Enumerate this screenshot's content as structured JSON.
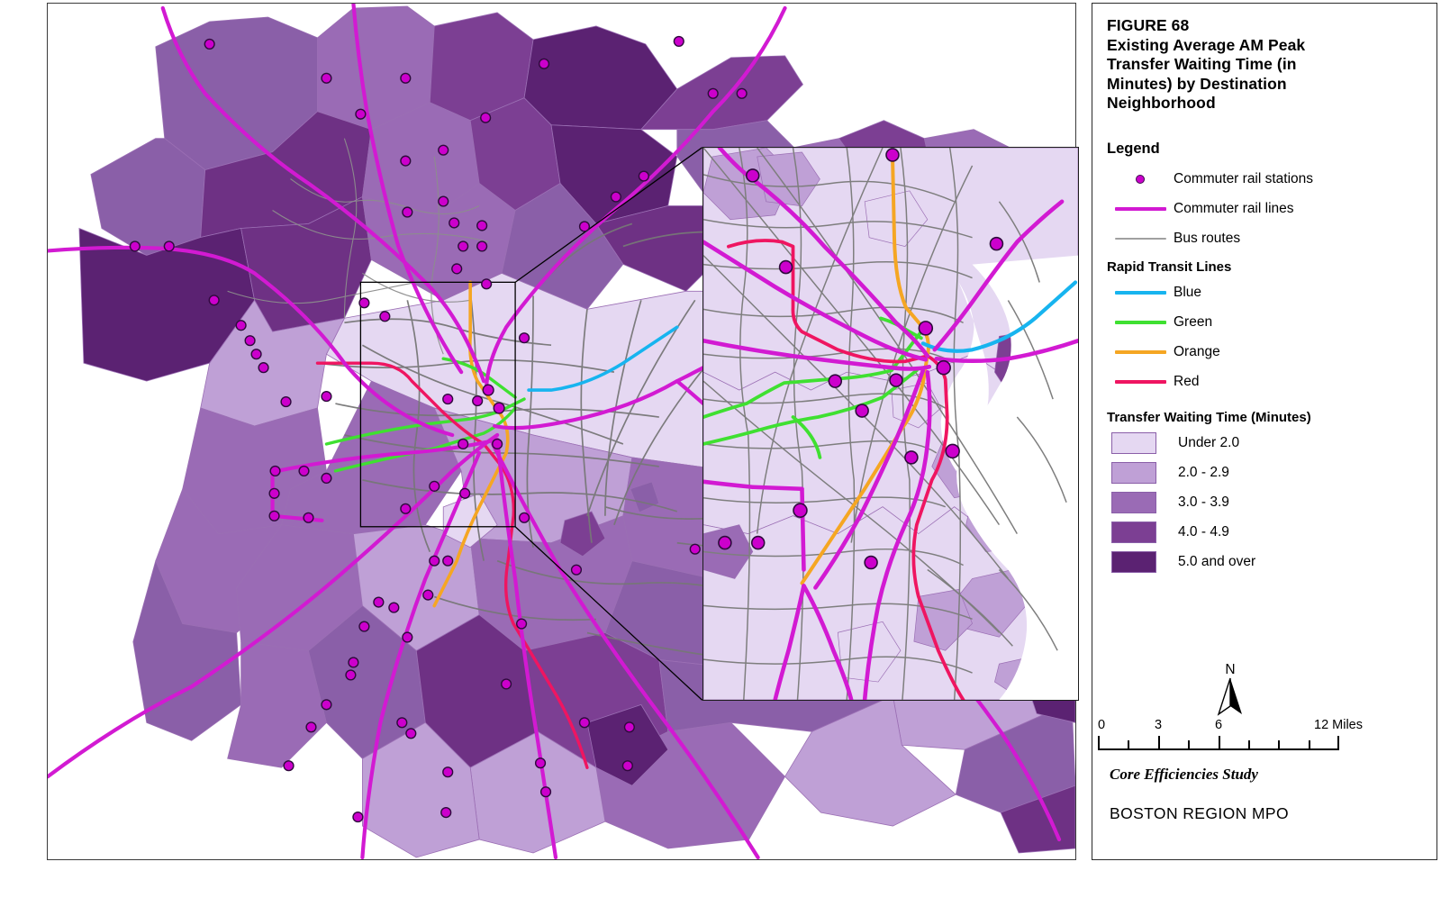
{
  "figure": {
    "number": "FIGURE 68",
    "title_lines": [
      "Existing Average AM Peak",
      "Transfer Waiting Time (in",
      "Minutes) by Destination",
      "Neighborhood"
    ]
  },
  "legend": {
    "heading": "Legend",
    "items": [
      {
        "label": "Commuter rail stations",
        "key": "dot",
        "color": "#cc00cc"
      },
      {
        "label": "Commuter rail lines",
        "key": "line",
        "color": "#d21ad2"
      },
      {
        "label": "Bus routes",
        "key": "thin",
        "color": "#a0a0a0"
      }
    ],
    "rapid_transit": {
      "heading": "Rapid Transit Lines",
      "lines": [
        {
          "label": "Blue",
          "color": "#17b4ef"
        },
        {
          "label": "Green",
          "color": "#3fe031"
        },
        {
          "label": "Orange",
          "color": "#f5a623"
        },
        {
          "label": "Red",
          "color": "#ef1561"
        }
      ]
    },
    "choropleth": {
      "heading": "Transfer Waiting Time (Minutes)",
      "classes": [
        {
          "label": "Under 2.0",
          "color": "#e5d8f2"
        },
        {
          "label": "2.0 - 2.9",
          "color": "#bfa0d6"
        },
        {
          "label": "3.0 - 3.9",
          "color": "#9a6bb5"
        },
        {
          "label": "4.0 - 4.9",
          "color": "#7c3f93"
        },
        {
          "label": "5.0 and over",
          "color": "#5b2272"
        }
      ]
    }
  },
  "north_arrow": {
    "label": "N"
  },
  "scale_bar": {
    "ticks": [
      "0",
      "3",
      "6",
      "12 Miles"
    ],
    "positions_pct": [
      0,
      25,
      50,
      100
    ]
  },
  "footer": {
    "study": "Core Efficiencies Study",
    "agency": "BOSTON REGION MPO"
  },
  "map": {
    "name": "boston-region-choropleth-map",
    "inset_name": "boston-core-inset-map"
  }
}
